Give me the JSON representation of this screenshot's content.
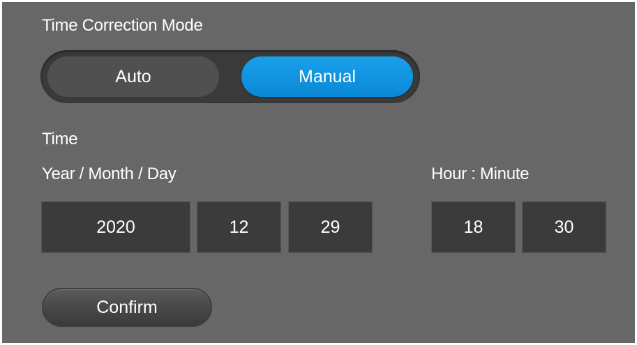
{
  "mode": {
    "title": "Time Correction Mode",
    "options": [
      {
        "label": "Auto",
        "selected": false
      },
      {
        "label": "Manual",
        "selected": true
      }
    ]
  },
  "time": {
    "title": "Time",
    "date_label": "Year / Month / Day",
    "clock_label": "Hour : Minute",
    "year": "2020",
    "month": "12",
    "day": "29",
    "hour": "18",
    "minute": "30"
  },
  "actions": {
    "confirm_label": "Confirm"
  },
  "colors": {
    "panel_bg": "#676767",
    "accent": "#0a88d6",
    "field_bg": "#3b3b3b"
  }
}
